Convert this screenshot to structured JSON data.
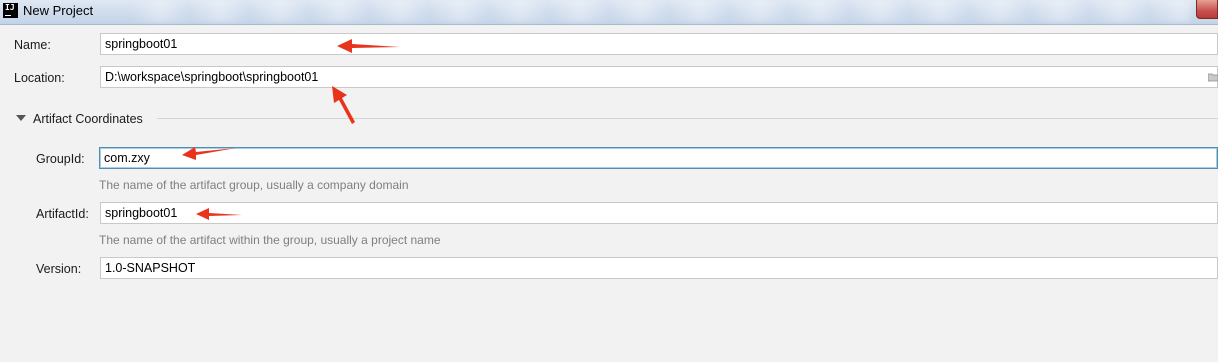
{
  "window": {
    "title": "New Project",
    "app_icon_text": "IJ"
  },
  "form": {
    "name": {
      "label": "Name:",
      "value": "springboot01"
    },
    "location": {
      "label": "Location:",
      "value": "D:\\workspace\\springboot\\springboot01"
    },
    "artifact_section": {
      "title": "Artifact Coordinates",
      "expanded": true,
      "group_id": {
        "label": "GroupId:",
        "value": "com.zxy",
        "hint": "The name of the artifact group, usually a company domain"
      },
      "artifact_id": {
        "label": "ArtifactId:",
        "value": "springboot01",
        "hint": "The name of the artifact within the group, usually a project name"
      },
      "version": {
        "label": "Version:",
        "value": "1.0-SNAPSHOT"
      }
    }
  },
  "icons": {
    "app": "intellij-icon",
    "toggle": "triangle-down-icon",
    "browse": "folder-icon",
    "annotation": "red-arrow"
  },
  "colors": {
    "annotation_arrow": "#e8341c",
    "focus_border": "#4f8fb5",
    "hint_text": "#7f7f7f",
    "background": "#f2f2f2"
  }
}
